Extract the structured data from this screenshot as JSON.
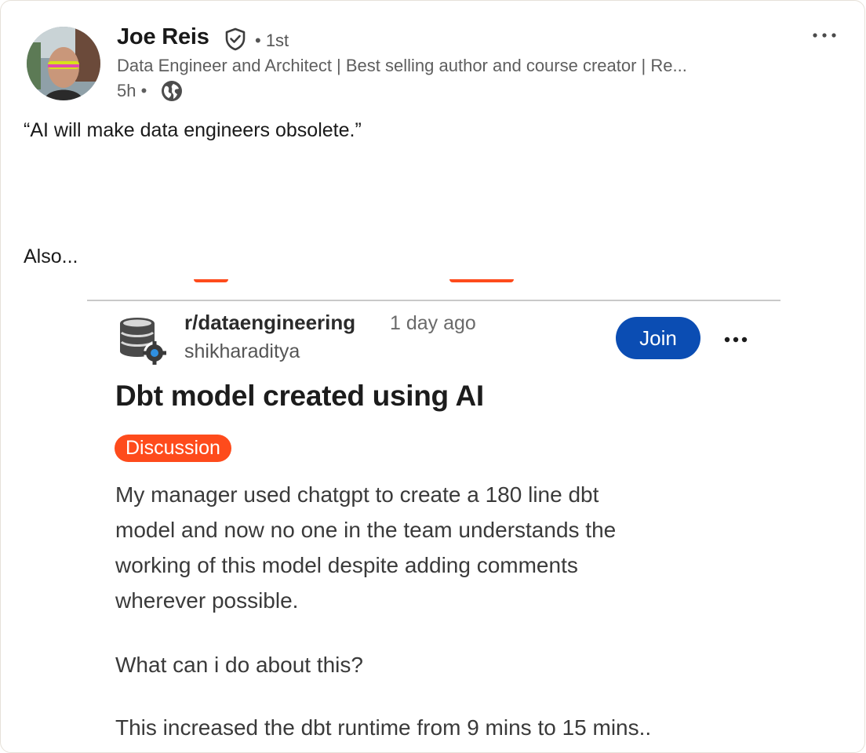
{
  "author": {
    "name": "Joe Reis",
    "connection_degree": "• 1st",
    "headline": "Data Engineer and Architect | Best selling author and course creator | Re...",
    "time_posted": "5h •",
    "avatar_icon": "profile-photo",
    "verified_icon": "verified-shield-icon",
    "visibility_icon": "globe-icon"
  },
  "post": {
    "line1": "“AI will make data engineers obsolete.”",
    "line2": "Also..."
  },
  "embedded_reddit": {
    "subreddit": "r/dataengineering",
    "age": "1 day ago",
    "username": "shikharaditya",
    "join_label": "Join",
    "title": "Dbt model created using AI",
    "flair": "Discussion",
    "body_lines": [
      "My manager used chatgpt to create a 180 line dbt",
      "model and now no one in the team understands the",
      "working of this model despite adding comments",
      "wherever possible."
    ],
    "question": "What can i do about this?",
    "runtime_note": "This increased the dbt runtime from 9 mins to 15 mins..",
    "accent_color": "#fe4b1c",
    "join_color": "#0b4db3"
  }
}
